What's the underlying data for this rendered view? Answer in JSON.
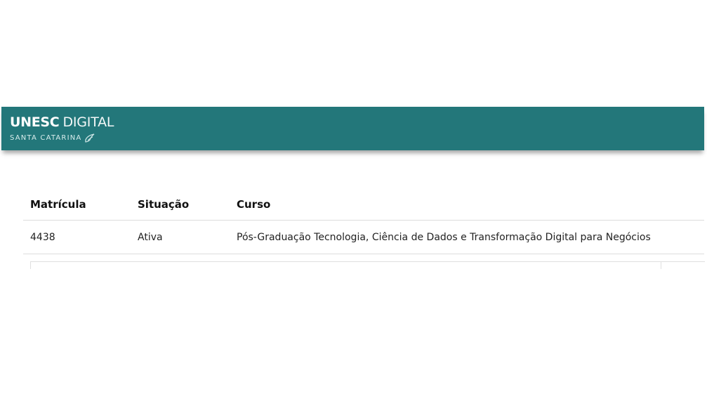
{
  "header": {
    "brand_strong": "UNESC",
    "brand_light": "DIGITAL",
    "brand_subtitle": "SANTA CATARINA",
    "emblem_icon": "bird-emblem-icon",
    "background_color": "#23777a"
  },
  "table": {
    "columns": [
      "Matrícula",
      "Situação",
      "Curso"
    ],
    "rows": [
      {
        "matricula": "4438",
        "situacao": "Ativa",
        "curso": "Pós-Graduação Tecnologia, Ciência de Dados e Transformação Digital para Negócios"
      }
    ]
  }
}
